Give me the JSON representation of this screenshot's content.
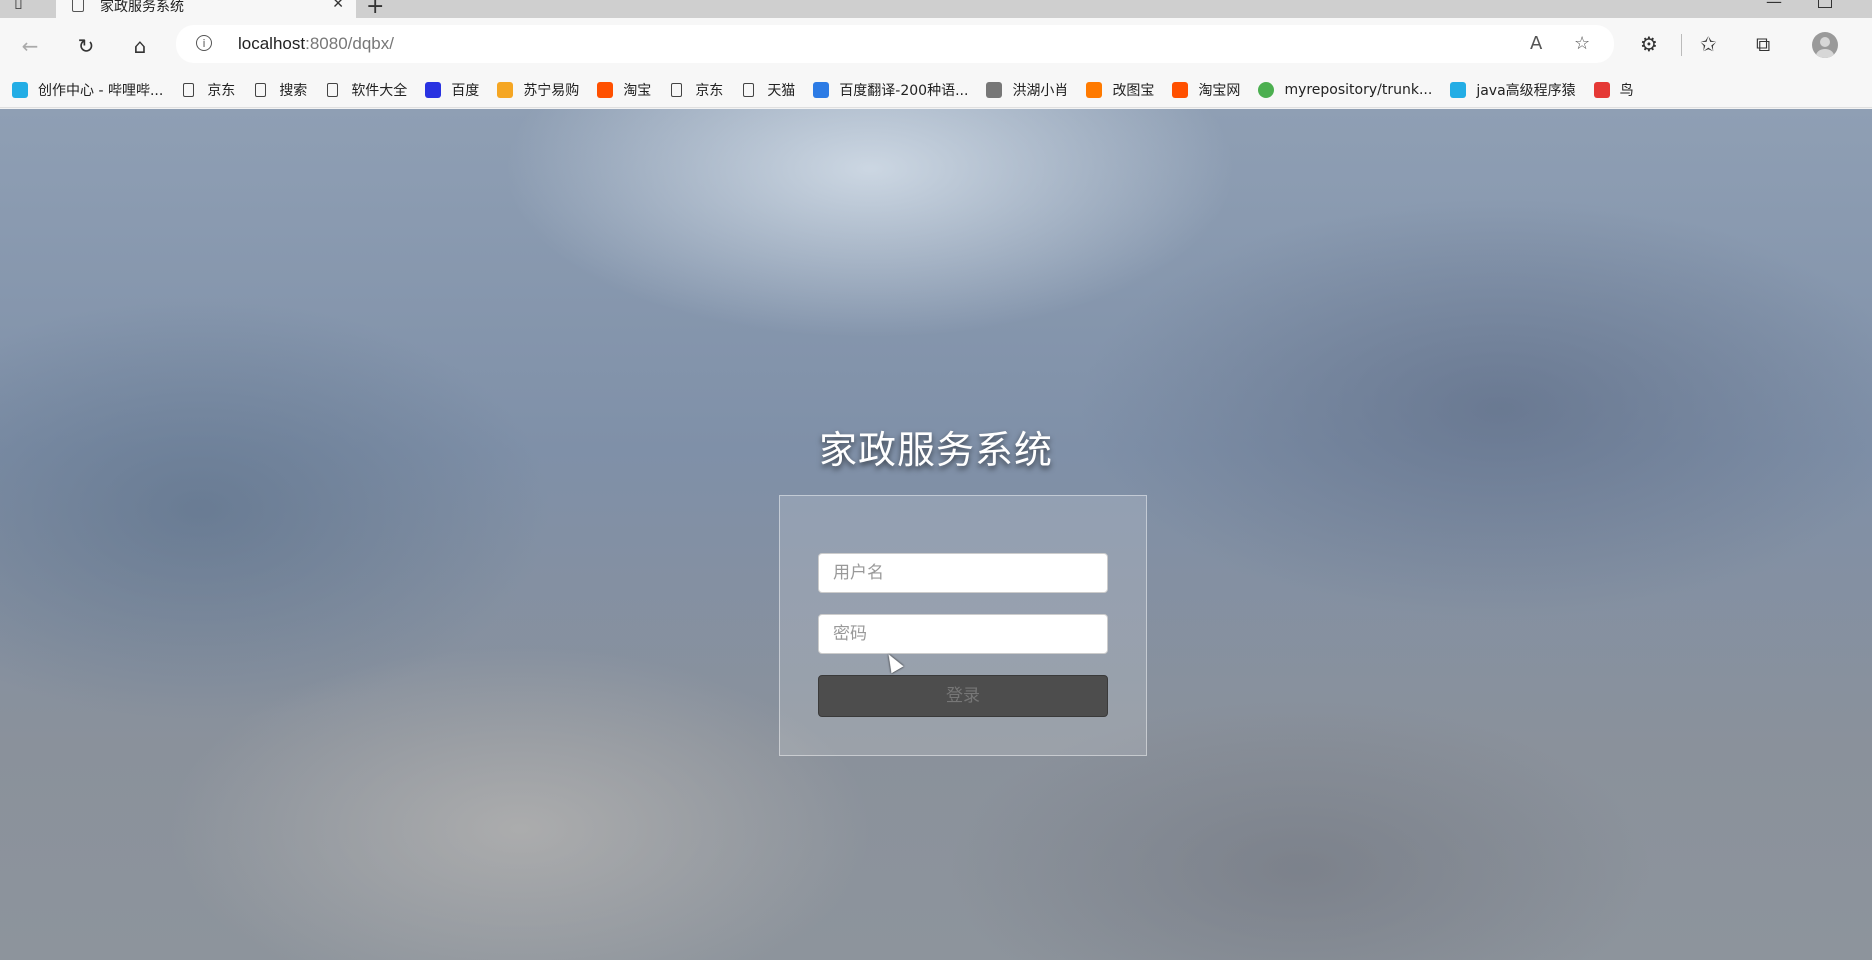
{
  "browser": {
    "tab_title": "家政服务系统",
    "url_host": "localhost",
    "url_rest": ":8080/dqbx/"
  },
  "bookmarks": [
    {
      "label": "创作中心 - 哔哩哔...",
      "icon": "bilibili-icon",
      "color": "#23ade5"
    },
    {
      "label": "京东",
      "icon": "page-icon"
    },
    {
      "label": "搜索",
      "icon": "page-icon"
    },
    {
      "label": "软件大全",
      "icon": "page-icon"
    },
    {
      "label": "百度",
      "icon": "baidu-icon",
      "color": "#2932e1"
    },
    {
      "label": "苏宁易购",
      "icon": "suning-icon",
      "color": "#f5a623"
    },
    {
      "label": "淘宝",
      "icon": "taobao-icon",
      "color": "#ff5000"
    },
    {
      "label": "京东",
      "icon": "page-icon"
    },
    {
      "label": "天猫",
      "icon": "page-icon"
    },
    {
      "label": "百度翻译-200种语...",
      "icon": "translate-icon",
      "color": "#2c7be5"
    },
    {
      "label": "洪湖小肖",
      "icon": "bird-icon",
      "color": "#777777"
    },
    {
      "label": "改图宝",
      "icon": "gaitubao-icon",
      "color": "#ff7a00"
    },
    {
      "label": "淘宝网",
      "icon": "taobao-icon",
      "color": "#ff5000"
    },
    {
      "label": "myrepository/trunk...",
      "icon": "chrome-icon",
      "color": "#4caf50"
    },
    {
      "label": "java高级程序猿",
      "icon": "bilibili-icon",
      "color": "#23ade5"
    },
    {
      "label": "鸟",
      "icon": "bird-red-icon",
      "color": "#e53935"
    }
  ],
  "login": {
    "title": "家政服务系统",
    "username_placeholder": "用户名",
    "password_placeholder": "密码",
    "submit_label": "登录"
  }
}
